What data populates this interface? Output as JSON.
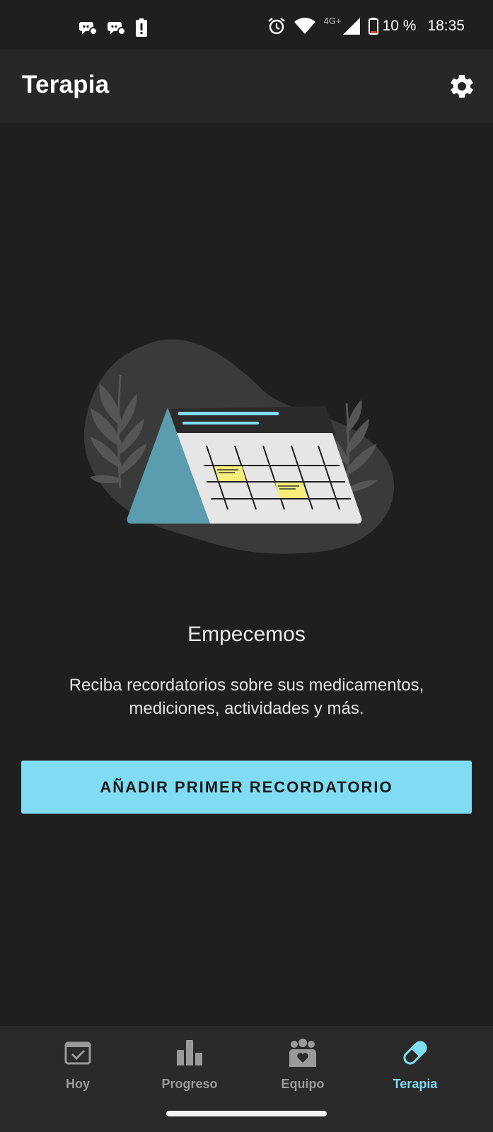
{
  "status_bar": {
    "network": "4G+",
    "battery": "10 %",
    "time": "18:35",
    "left_icons": [
      "chat-bubble-icon",
      "chat-bubble-icon",
      "battery-alert-icon"
    ],
    "right_icons": [
      "alarm-icon",
      "wifi-icon",
      "signal-icon",
      "battery-icon"
    ]
  },
  "app_bar": {
    "title": "Terapia",
    "settings_icon": "gear-icon"
  },
  "empty_state": {
    "headline": "Empecemos",
    "description": "Reciba recordatorios sobre sus medicamentos, mediciones, actividades y más.",
    "button_label": "AÑADIR PRIMER RECORDATORIO"
  },
  "bottom_nav": {
    "items": [
      {
        "label": "Hoy",
        "icon": "calendar-check-icon",
        "active": false
      },
      {
        "label": "Progreso",
        "icon": "bar-chart-icon",
        "active": false
      },
      {
        "label": "Equipo",
        "icon": "team-heart-icon",
        "active": false
      },
      {
        "label": "Terapia",
        "icon": "pill-icon",
        "active": true
      }
    ]
  },
  "colors": {
    "background": "#1f1f1f",
    "app_bar": "#272727",
    "accent": "#7fdcf3",
    "nav_bar": "#2a2a2a"
  }
}
